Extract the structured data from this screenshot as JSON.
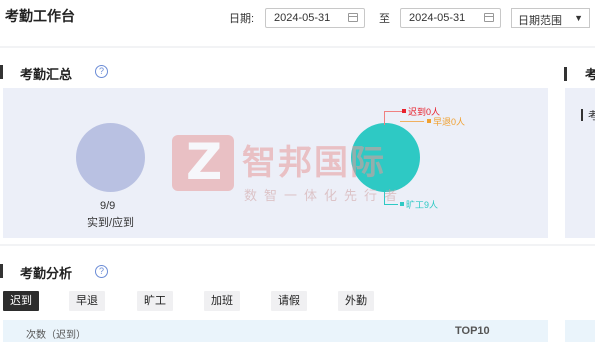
{
  "header": {
    "title": "考勤工作台",
    "date_label": "日期:",
    "start_date": "2024-05-31",
    "separator": "至",
    "end_date": "2024-05-31",
    "range_select": "日期范围"
  },
  "summary": {
    "title": "考勤汇总",
    "help_icon": "question-circle-icon",
    "attendance_value": "9/9",
    "attendance_label": "实到/应到",
    "legend": [
      {
        "label": "迟到0人",
        "color": "#e8212d"
      },
      {
        "label": "早退0人",
        "color": "#f0a030"
      },
      {
        "label": "旷工9人",
        "color": "#2ec9c4"
      }
    ]
  },
  "watermark": {
    "logo_letter": "Z",
    "name": "智邦国际",
    "slogan": "数智一体化先行者"
  },
  "analysis": {
    "title": "考勤分析",
    "help_icon": "question-circle-icon",
    "tabs": [
      "迟到",
      "早退",
      "旷工",
      "加班",
      "请假",
      "外勤"
    ],
    "active_tab": "迟到",
    "table_header_count": "次数（迟到）",
    "table_header_top": "TOP10"
  },
  "right_panel": {
    "title": "考",
    "inner_text": "考"
  }
}
